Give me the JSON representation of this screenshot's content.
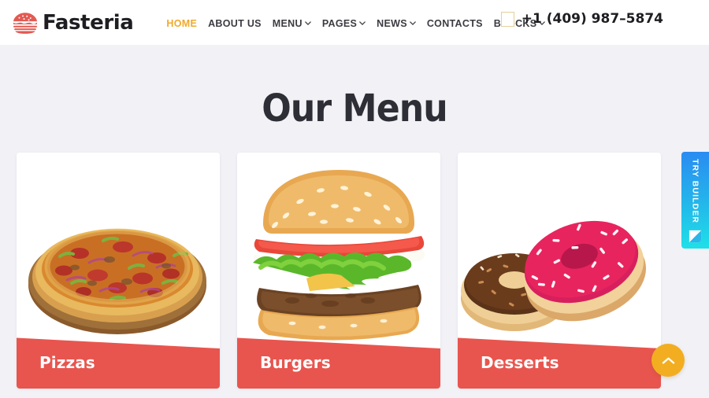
{
  "header": {
    "brand": {
      "name": "Fasteria",
      "icon": "burger-logo-icon"
    },
    "nav": [
      {
        "label": "HOME",
        "active": true,
        "dropdown": false
      },
      {
        "label": "ABOUT US",
        "active": false,
        "dropdown": false
      },
      {
        "label": "MENU",
        "active": false,
        "dropdown": true
      },
      {
        "label": "PAGES",
        "active": false,
        "dropdown": true
      },
      {
        "label": "NEWS",
        "active": false,
        "dropdown": true
      },
      {
        "label": "CONTACTS",
        "active": false,
        "dropdown": false
      },
      {
        "label": "BLOCKS",
        "active": false,
        "dropdown": true
      }
    ],
    "phone": {
      "number": "+1 (409) 987–5874",
      "icon": "phone-icon"
    }
  },
  "main": {
    "section_title": "Our Menu",
    "cards": [
      {
        "label": "Pizzas",
        "image": "pizza-photo"
      },
      {
        "label": "Burgers",
        "image": "burger-photo"
      },
      {
        "label": "Desserts",
        "image": "desserts-photo"
      }
    ]
  },
  "widgets": {
    "try_builder": {
      "label": "TRY BUILDER",
      "icon": "builder-logo-icon"
    },
    "scroll_top": {
      "icon": "chevron-up-icon"
    }
  },
  "colors": {
    "page_bg": "#f1f1f6",
    "header_bg": "#ffffff",
    "accent_red": "#e8554e",
    "accent_orange": "#f0a92b",
    "scroll_top_orange": "#f2ae20",
    "title_dark": "#2e2e36",
    "builder_blue": "#2a8bf2",
    "builder_cyan": "#1ee0e8"
  }
}
